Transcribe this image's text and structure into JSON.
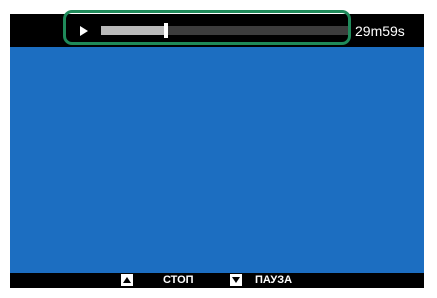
{
  "playback": {
    "state_icon": "play-icon",
    "progress": 0.26,
    "time_remaining": "29m59s"
  },
  "video": {
    "background_color": "#1c6ec1"
  },
  "highlight": {
    "color": "#1f8a5a"
  },
  "controls": {
    "stop_icon": "up-triangle-icon",
    "stop_label": "СТОП",
    "pause_icon": "down-triangle-icon",
    "pause_label": "ПАУЗА"
  }
}
